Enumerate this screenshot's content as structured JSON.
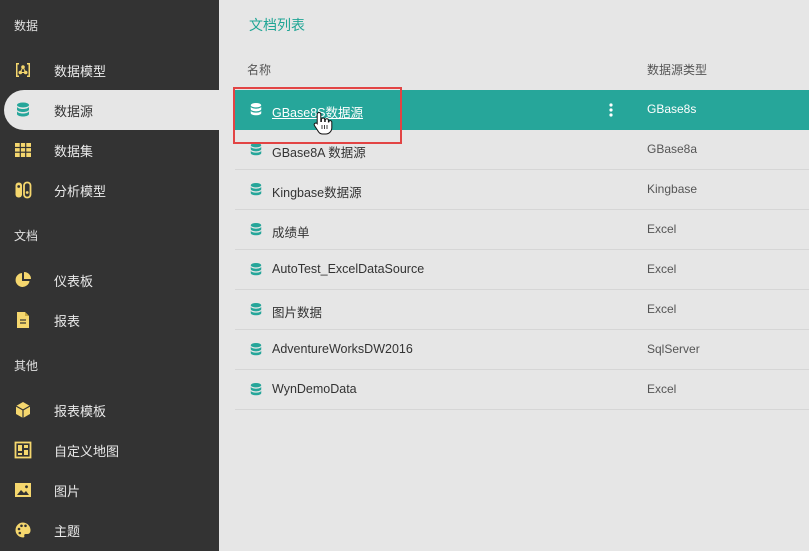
{
  "sidebar": {
    "sections": {
      "data": "数据",
      "docs": "文档",
      "other": "其他"
    },
    "items": [
      {
        "label": "数据模型",
        "icon": "data-model-icon"
      },
      {
        "label": "数据源",
        "icon": "database-icon"
      },
      {
        "label": "数据集",
        "icon": "grid-table-icon"
      },
      {
        "label": "分析模型",
        "icon": "switch-icon"
      },
      {
        "label": "仪表板",
        "icon": "pie-chart-icon"
      },
      {
        "label": "报表",
        "icon": "document-icon"
      },
      {
        "label": "报表模板",
        "icon": "cube-icon"
      },
      {
        "label": "自定义地图",
        "icon": "map-layout-icon"
      },
      {
        "label": "图片",
        "icon": "image-icon"
      },
      {
        "label": "主题",
        "icon": "palette-icon"
      }
    ],
    "active_index": 1
  },
  "main": {
    "title": "文档列表",
    "columns": {
      "name": "名称",
      "type": "数据源类型"
    },
    "rows": [
      {
        "name": "GBase8S数据源",
        "type": "GBase8s"
      },
      {
        "name": "GBase8A 数据源",
        "type": "GBase8a"
      },
      {
        "name": "Kingbase数据源",
        "type": "Kingbase"
      },
      {
        "name": "成绩单",
        "type": "Excel"
      },
      {
        "name": "AutoTest_ExcelDataSource",
        "type": "Excel"
      },
      {
        "name": "图片数据",
        "type": "Excel"
      },
      {
        "name": "AdventureWorksDW2016",
        "type": "SqlServer"
      },
      {
        "name": "WynDemoData",
        "type": "Excel"
      }
    ],
    "selected_index": 0
  },
  "colors": {
    "sidebar_bg": "#333333",
    "accent": "#26a69a",
    "icon_yellow": "#f5d76e",
    "highlight_border": "#e24444"
  }
}
